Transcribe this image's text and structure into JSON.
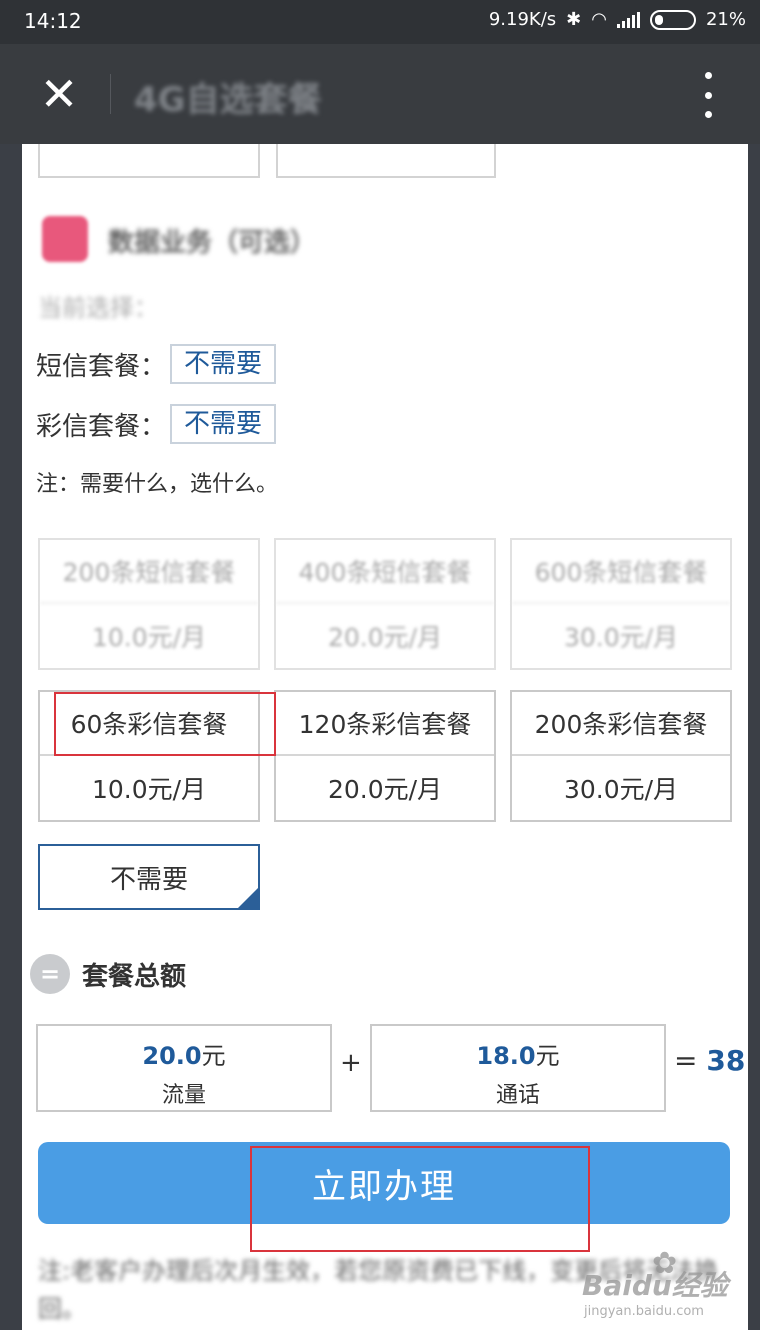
{
  "status_bar": {
    "time": "14:12",
    "network_speed": "9.19K/s",
    "battery": "21%"
  },
  "nav": {
    "title": "4G自选套餐"
  },
  "data_section": {
    "title": "数据业务（可选）",
    "current_selection_label": "当前选择："
  },
  "selections": [
    {
      "label": "短信套餐：",
      "value": "不需要"
    },
    {
      "label": "彩信套餐：",
      "value": "不需要"
    }
  ],
  "note": "注：需要什么，选什么。",
  "sms_packages": [
    {
      "name": "200条短信套餐",
      "price": "10.0元/月"
    },
    {
      "name": "400条短信套餐",
      "price": "20.0元/月"
    },
    {
      "name": "600条短信套餐",
      "price": "30.0元/月"
    }
  ],
  "mms_packages": [
    {
      "name": "60条彩信套餐",
      "price": "10.0元/月"
    },
    {
      "name": "120条彩信套餐",
      "price": "20.0元/月"
    },
    {
      "name": "200条彩信套餐",
      "price": "30.0元/月"
    }
  ],
  "none_option": "不需要",
  "total": {
    "title": "套餐总额",
    "items": [
      {
        "amount": "20.0",
        "unit": "元",
        "label": "流量"
      },
      {
        "amount": "18.0",
        "unit": "元",
        "label": "通话"
      }
    ],
    "plus": "+",
    "equals": "=",
    "sum": "38"
  },
  "apply_button": "立即办理",
  "footer_note": "注:老客户办理后次月生效，若您原资费已下线，变更后将无法换回。",
  "watermark": {
    "brand": "Baidu经验",
    "url": "jingyan.baidu.com"
  }
}
